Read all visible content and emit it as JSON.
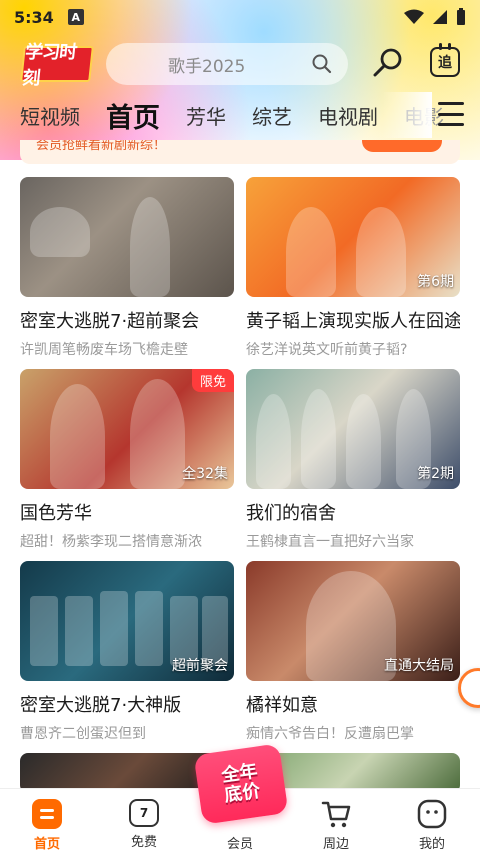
{
  "status": {
    "time": "5:34",
    "notif_letter": "A"
  },
  "header": {
    "logo_text": "学习时刻",
    "search_placeholder": "歌手2025",
    "follow_label": "追"
  },
  "tabs": [
    {
      "label": "短视频"
    },
    {
      "label": "首页"
    },
    {
      "label": "芳华"
    },
    {
      "label": "综艺"
    },
    {
      "label": "电视剧"
    },
    {
      "label": "电影"
    }
  ],
  "promo": {
    "text": "会员抢鲜看新剧新综！"
  },
  "cards": [
    {
      "title": "密室大逃脱7·超前聚会",
      "subtitle": "许凯周笔畅废车场飞檐走壁",
      "badge": "",
      "corner": ""
    },
    {
      "title": "黄子韬上演现实版人在囧途",
      "subtitle": "徐艺洋说英文听前黄子韬?",
      "badge": "第6期",
      "corner": ""
    },
    {
      "title": "国色芳华",
      "subtitle": "超甜！杨紫李现二搭情意渐浓",
      "badge": "全32集",
      "corner": "限免"
    },
    {
      "title": "我们的宿舍",
      "subtitle": "王鹤棣直言一直把好六当家",
      "badge": "第2期",
      "corner": ""
    },
    {
      "title": "密室大逃脱7·大神版",
      "subtitle": "曹恩齐二创蛋迟但到",
      "badge": "超前聚会",
      "corner": ""
    },
    {
      "title": "橘祥如意",
      "subtitle": "痴情六爷告白！反遭扇巴掌",
      "badge": "直通大结局",
      "corner": ""
    }
  ],
  "bottom_nav": [
    {
      "label": "首页",
      "active": true
    },
    {
      "label": "免费",
      "active": false
    },
    {
      "label": "会员",
      "active": false
    },
    {
      "label": "周边",
      "active": false
    },
    {
      "label": "我的",
      "active": false
    }
  ],
  "vip_badge": {
    "line1": "全年",
    "line2": "底价"
  },
  "colors": {
    "accent": "#ff6a00",
    "vip": "#ff2a5a",
    "logo": "#e3222a"
  }
}
